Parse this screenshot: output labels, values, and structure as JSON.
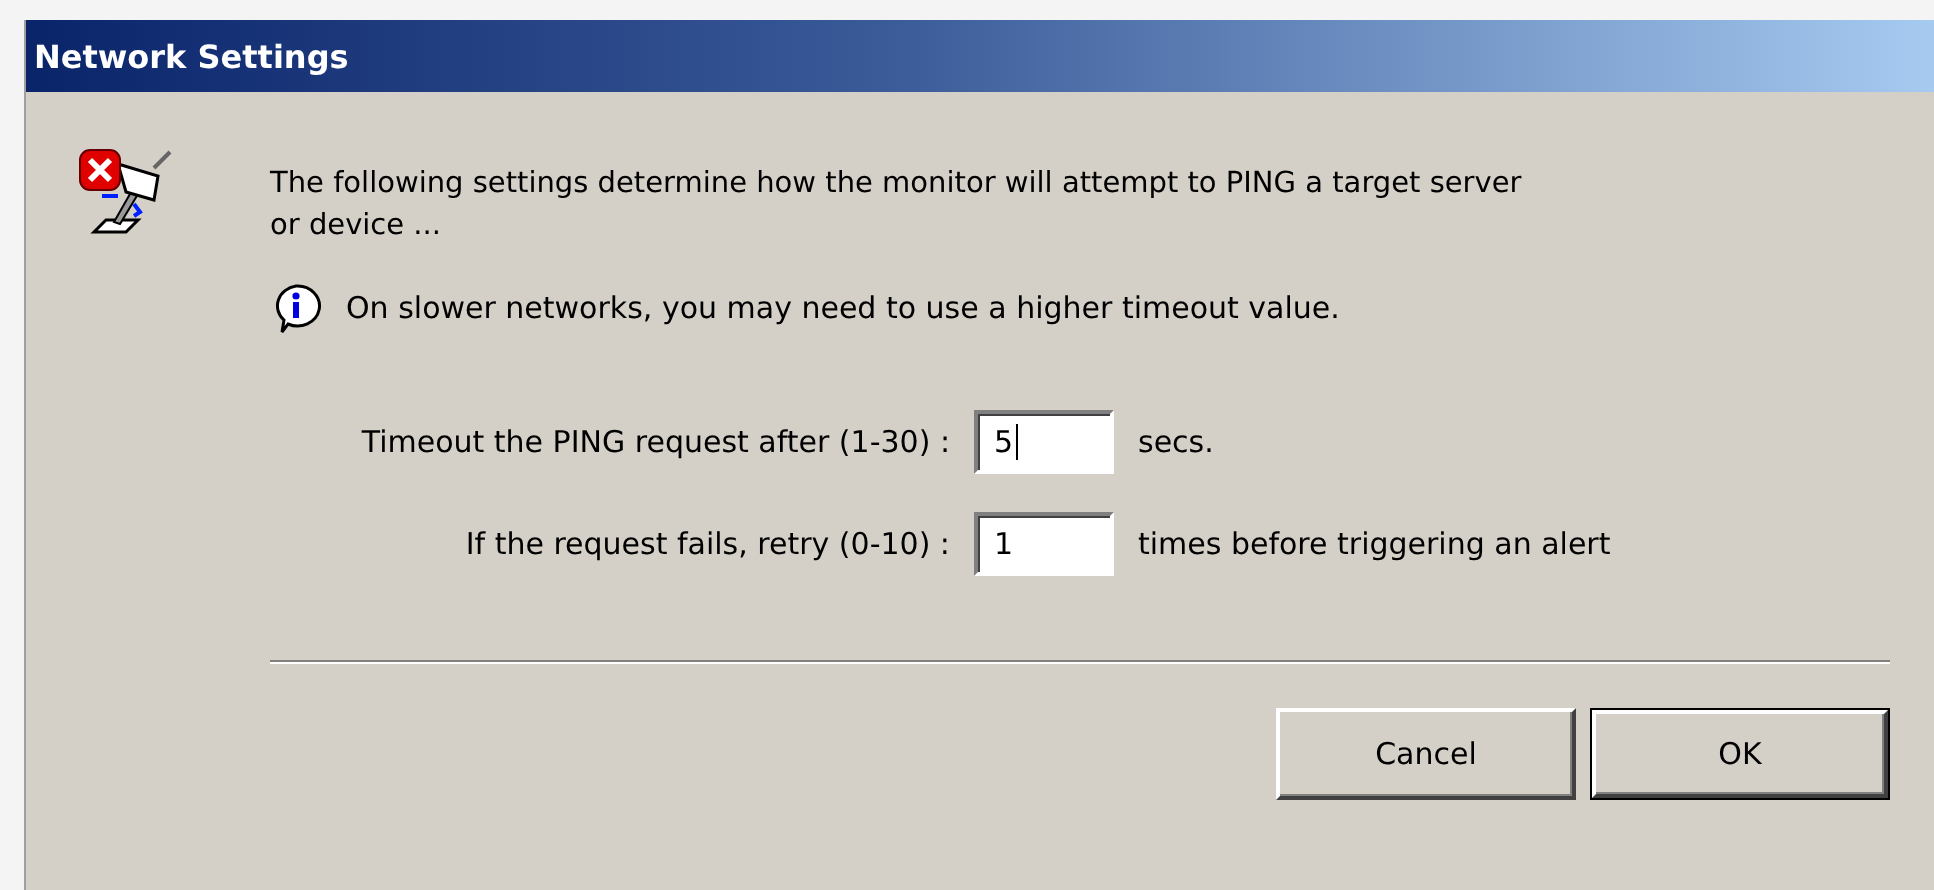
{
  "window": {
    "title": "Network Settings"
  },
  "description": "The following settings determine how the monitor will attempt to PING a target server or device ...",
  "info": "On slower networks, you may need to use a higher timeout value.",
  "fields": [
    {
      "label": "Timeout the PING request after (1-30) :",
      "value": "5",
      "unit": "secs.",
      "focused": true
    },
    {
      "label": "If the request fails, retry (0-10) :",
      "value": "1",
      "unit": "times before triggering an alert",
      "focused": false
    }
  ],
  "buttons": [
    {
      "label": "Cancel",
      "default": false
    },
    {
      "label": "OK",
      "default": true
    }
  ]
}
